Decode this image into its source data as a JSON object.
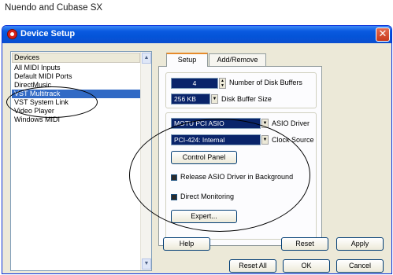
{
  "caption": "Nuendo and Cubase SX",
  "window": {
    "title": "Device Setup",
    "close_glyph": "✕"
  },
  "devices": {
    "header": "Devices",
    "items": [
      {
        "label": "All MIDI Inputs",
        "selected": false
      },
      {
        "label": "Default MIDI Ports",
        "selected": false
      },
      {
        "label": "DirectMusic",
        "selected": false
      },
      {
        "label": "VST Multitrack",
        "selected": true
      },
      {
        "label": "VST System Link",
        "selected": false
      },
      {
        "label": "Video Player",
        "selected": false
      },
      {
        "label": "Windows MIDI",
        "selected": false
      }
    ]
  },
  "tabs": {
    "setup": "Setup",
    "add_remove": "Add/Remove",
    "active": "Setup"
  },
  "settings": {
    "disk_buffers_value": "4",
    "disk_buffers_label": "Number of Disk Buffers",
    "disk_buffer_size_value": "256 KB",
    "disk_buffer_size_label": "Disk Buffer Size",
    "asio_driver_value": "MOTU PCI ASIO",
    "asio_driver_label": "ASIO Driver",
    "clock_source_value": "PCI-424: Internal",
    "clock_source_label": "Clock Source",
    "control_panel_button": "Control Panel",
    "release_asio_label": "Release ASIO Driver in Background",
    "release_asio_checked": true,
    "direct_monitoring_label": "Direct Monitoring",
    "direct_monitoring_checked": true,
    "expert_button": "Expert..."
  },
  "buttons": {
    "help": "Help",
    "reset": "Reset",
    "apply": "Apply",
    "reset_all": "Reset All",
    "ok": "OK",
    "cancel": "Cancel"
  },
  "colors": {
    "titlebar": "#0454d8",
    "selection": "#316ac5",
    "dialog_bg": "#ece9d8"
  }
}
